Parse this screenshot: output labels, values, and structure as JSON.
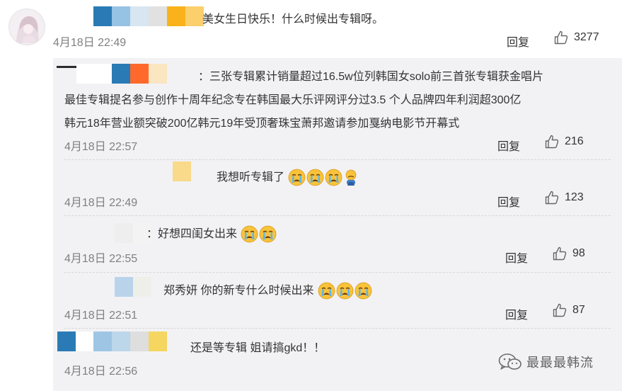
{
  "main_comment": {
    "text": "美女生日快乐！什么时候出专辑呀。",
    "time": "4月18日 22:49",
    "reply_label": "回复",
    "likes": "3277"
  },
  "replies": [
    {
      "lines": [
        "：三张专辑累计销量超过16.5w位列韩国女solo前三首张专辑获金唱片",
        "最佳专辑提名参与创作十周年纪念专在韩国最大乐评网评分过3.5 个人品牌四年利润超300亿",
        "韩元18年营业额突破200亿韩元19年受顶奢珠宝萧邦邀请参加戛纳电影节开幕式"
      ],
      "time": "4月18日 22:57",
      "reply_label": "回复",
      "likes": "216"
    },
    {
      "text": "我想听专辑了",
      "time": "4月18日 22:49",
      "reply_label": "回复",
      "likes": "123"
    },
    {
      "text": "：好想四闺女出来",
      "time": "4月18日 22:55",
      "reply_label": "回复",
      "likes": "98"
    },
    {
      "text": "郑秀妍 你的新专什么时候出来",
      "time": "4月18日 22:51",
      "reply_label": "回复",
      "likes": "87"
    },
    {
      "text": "还是等专辑 姐请搞gkd！！",
      "time": "4月18日 22:56"
    }
  ],
  "watermark": {
    "text": "最最最韩流"
  },
  "colors": {
    "text": "#333333",
    "time": "#808080",
    "panel": "#f2f2f5",
    "mosaic_blue": "#2a7bb5",
    "mosaic_orange": "#ff6a2c",
    "mosaic_yellow": "#f7c94a"
  },
  "icons": [
    "thumbs-up-icon",
    "crying-face-emoji",
    "pouting-face-emoji",
    "wechat-icon"
  ]
}
